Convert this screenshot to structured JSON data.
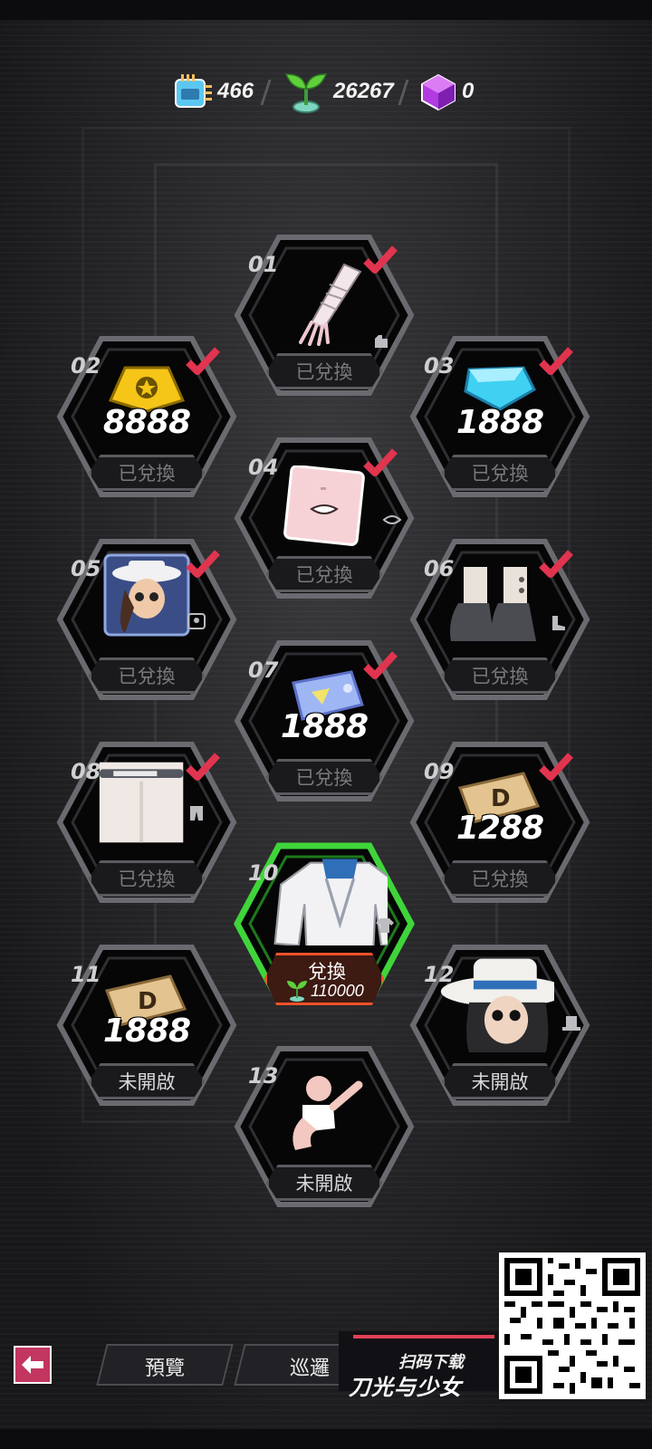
{
  "currencies": [
    {
      "name": "chip-currency",
      "value": "466"
    },
    {
      "name": "sprout-currency",
      "value": "26267"
    },
    {
      "name": "cube-currency",
      "value": "0"
    }
  ],
  "items": [
    {
      "num": "01",
      "status": "已兌換",
      "state": "redeemed",
      "amount": "",
      "icon": "glove-icon",
      "type_icon": "glove-type-icon"
    },
    {
      "num": "02",
      "status": "已兌換",
      "state": "redeemed",
      "amount": "8888",
      "icon": "gold-badge-icon",
      "type_icon": ""
    },
    {
      "num": "03",
      "status": "已兌換",
      "state": "redeemed",
      "amount": "1888",
      "icon": "blue-gem-icon",
      "type_icon": ""
    },
    {
      "num": "04",
      "status": "已兌換",
      "state": "redeemed",
      "amount": "",
      "icon": "mouth-sticker-icon",
      "type_icon": "lips-type-icon"
    },
    {
      "num": "05",
      "status": "已兌換",
      "state": "redeemed",
      "amount": "",
      "icon": "avatar-portrait-icon",
      "type_icon": "portrait-type-icon"
    },
    {
      "num": "06",
      "status": "已兌換",
      "state": "redeemed",
      "amount": "",
      "icon": "boots-icon",
      "type_icon": "boot-type-icon"
    },
    {
      "num": "07",
      "status": "已兌換",
      "state": "redeemed",
      "amount": "1888",
      "icon": "holo-ticket-icon",
      "type_icon": ""
    },
    {
      "num": "08",
      "status": "已兌換",
      "state": "redeemed",
      "amount": "",
      "icon": "pants-icon",
      "type_icon": "pants-type-icon"
    },
    {
      "num": "09",
      "status": "已兌換",
      "state": "redeemed",
      "amount": "1288",
      "icon": "d-ticket-icon",
      "type_icon": ""
    },
    {
      "num": "10",
      "status": "兌換",
      "state": "available",
      "amount": "",
      "icon": "jacket-icon",
      "type_icon": "shirt-type-icon",
      "cost": "110000"
    },
    {
      "num": "11",
      "status": "未開啟",
      "state": "locked",
      "amount": "1888",
      "icon": "d-ticket-icon",
      "type_icon": ""
    },
    {
      "num": "12",
      "status": "未開啟",
      "state": "locked",
      "amount": "",
      "icon": "hat-hair-icon",
      "type_icon": "hat-type-icon"
    },
    {
      "num": "13",
      "status": "未開啟",
      "state": "locked",
      "amount": "",
      "icon": "pose-icon",
      "type_icon": ""
    }
  ],
  "nav": {
    "preview": "預覽",
    "patrol": "巡邏"
  },
  "promo": {
    "scan_text": "扫码下载",
    "logo": "刀光与少女"
  },
  "colors": {
    "hex_border": "#6b6a70",
    "active_border": "#3fd53a",
    "check": "#e1344f",
    "redeem_border": "#f0512a"
  }
}
